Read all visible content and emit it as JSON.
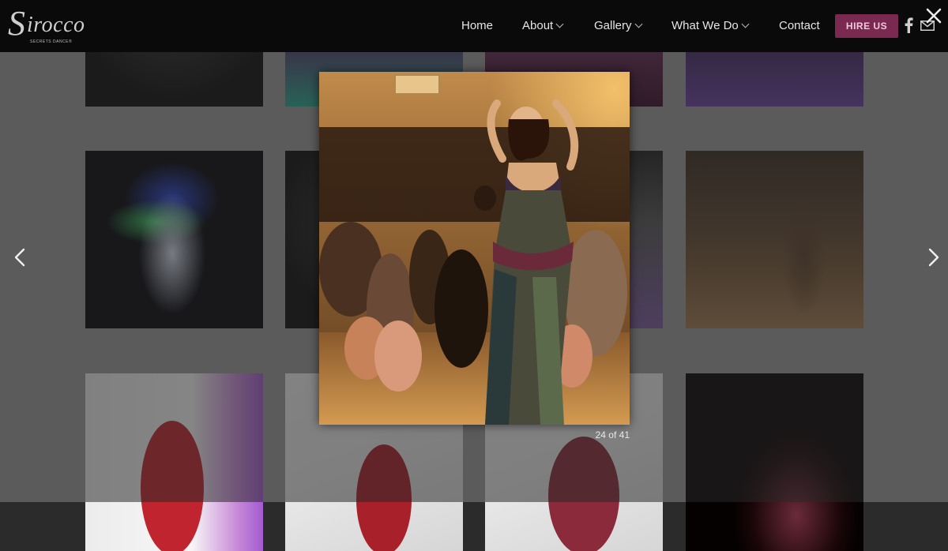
{
  "logo": {
    "text": "irocco",
    "initial": "S",
    "tagline": "SECRETS DANCE®"
  },
  "nav": {
    "items": [
      {
        "label": "Home",
        "has_dropdown": false
      },
      {
        "label": "About",
        "has_dropdown": true
      },
      {
        "label": "Gallery",
        "has_dropdown": true
      },
      {
        "label": "What We Do",
        "has_dropdown": true
      },
      {
        "label": "Contact",
        "has_dropdown": false
      }
    ],
    "hire_label": "HIRE US",
    "social": [
      "facebook-icon",
      "mail-icon"
    ]
  },
  "lightbox": {
    "counter": "24 of 41",
    "close_icon": "close-icon",
    "prev_icon": "chevron-left-icon",
    "next_icon": "chevron-right-icon"
  },
  "colors": {
    "header_bg": "#0a0a0a",
    "hire_bg": "#7a2a50",
    "hire_text": "#f0c8dd",
    "overlay": "rgba(40,40,40,0.55)"
  }
}
